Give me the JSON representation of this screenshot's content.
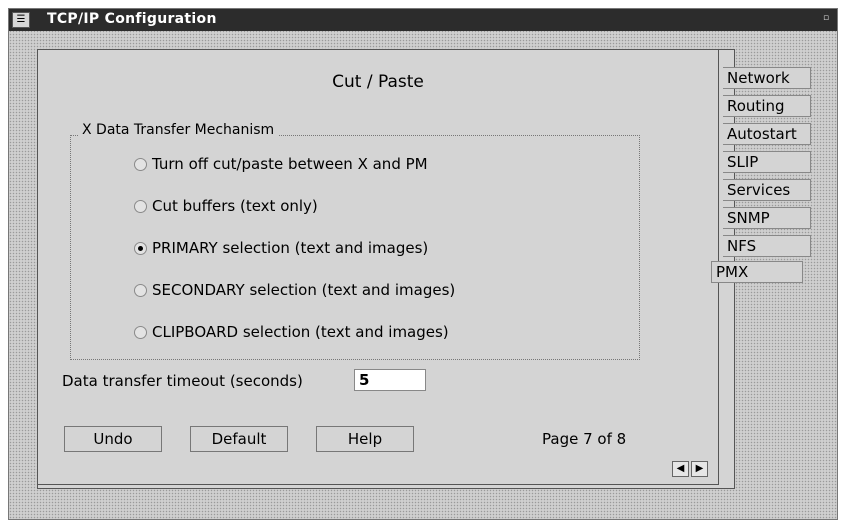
{
  "window": {
    "title": "TCP/IP Configuration",
    "sysmenu_icon": "system-menu-icon",
    "restore_icon": "restore-icon"
  },
  "page": {
    "title": "Cut / Paste",
    "group_title": "X Data Transfer Mechanism",
    "options": [
      {
        "label": "Turn off cut/paste between X and PM",
        "checked": false
      },
      {
        "label": "Cut buffers (text only)",
        "checked": false
      },
      {
        "label": "PRIMARY selection (text and images)",
        "checked": true
      },
      {
        "label": "SECONDARY selection (text and images)",
        "checked": false
      },
      {
        "label": "CLIPBOARD selection (text and images)",
        "checked": false
      }
    ],
    "timeout_label": "Data transfer timeout (seconds)",
    "timeout_value": "5",
    "buttons": {
      "undo": "Undo",
      "default": "Default",
      "help": "Help"
    },
    "page_indicator": "Page 7 of 8",
    "prev_icon": "arrow-left-icon",
    "next_icon": "arrow-right-icon"
  },
  "tabs": [
    {
      "label": "Network"
    },
    {
      "label": "Routing"
    },
    {
      "label": "Autostart"
    },
    {
      "label": "SLIP"
    },
    {
      "label": "Services"
    },
    {
      "label": "SNMP"
    },
    {
      "label": "NFS"
    },
    {
      "label": "PMX"
    }
  ]
}
